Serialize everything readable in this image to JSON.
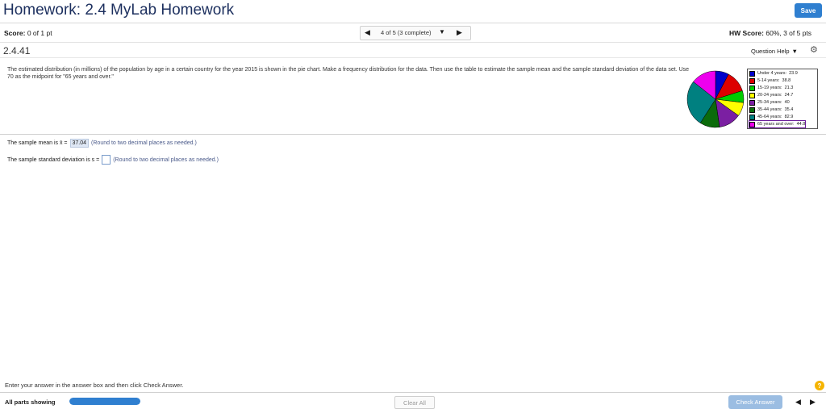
{
  "header": {
    "title": "Homework: 2.4 MyLab Homework",
    "save_label": "Save",
    "accent": "#2f7fd0"
  },
  "score": {
    "label": "Score:",
    "value": "0 of 1 pt"
  },
  "nav": {
    "prev_icon": "triangle-left-icon",
    "status": "4 of 5 (3 complete)",
    "dropdown_icon": "caret-down-icon",
    "next_icon": "triangle-right-icon"
  },
  "hw_score": {
    "label": "HW Score:",
    "value": "60%, 3 of 5 pts"
  },
  "question": {
    "number": "2.4.41",
    "help_label": "Question Help",
    "text": "The estimated distribution (in millions) of the population by age in a certain country for the year 2015 is shown in the pie chart. Make a frequency distribution for the data. Then use the table to estimate the sample mean and the sample standard deviation of the data set. Use 70 as the midpoint for \"65 years and over.\""
  },
  "legend": [
    {
      "label": "Under 4 years:",
      "value": "23.9",
      "color": "#0000cc"
    },
    {
      "label": "5-14 years:",
      "value": "38.8",
      "color": "#dd0000"
    },
    {
      "label": "15-19 years:",
      "value": "21.3",
      "color": "#00cc00"
    },
    {
      "label": "20-24 years:",
      "value": "24.7",
      "color": "#ffff00"
    },
    {
      "label": "25-34 years:",
      "value": "40",
      "color": "#7b1fa2"
    },
    {
      "label": "35-44 years:",
      "value": "35.4",
      "color": "#0b6b0b"
    },
    {
      "label": "45-64 years:",
      "value": "82.9",
      "color": "#008080"
    },
    {
      "label": "65 years and over:",
      "value": "44.8",
      "color": "#ee00ee"
    }
  ],
  "answers": {
    "mean_prefix": "The sample mean is x̄ =",
    "mean_value": "37.04",
    "mean_hint": "(Round to two decimal places as needed.)",
    "sd_prefix": "The sample standard deviation is s =",
    "sd_hint": "(Round to two decimal places as needed.)"
  },
  "footer": {
    "instruction": "Enter your answer in the answer box and then click Check Answer.",
    "help_glyph": "?",
    "parts_label": "All parts showing",
    "progress_fraction": 1.0,
    "clear_label": "Clear All",
    "check_label": "Check Answer",
    "prev_icon": "triangle-left-icon",
    "next_icon": "triangle-right-icon"
  }
}
